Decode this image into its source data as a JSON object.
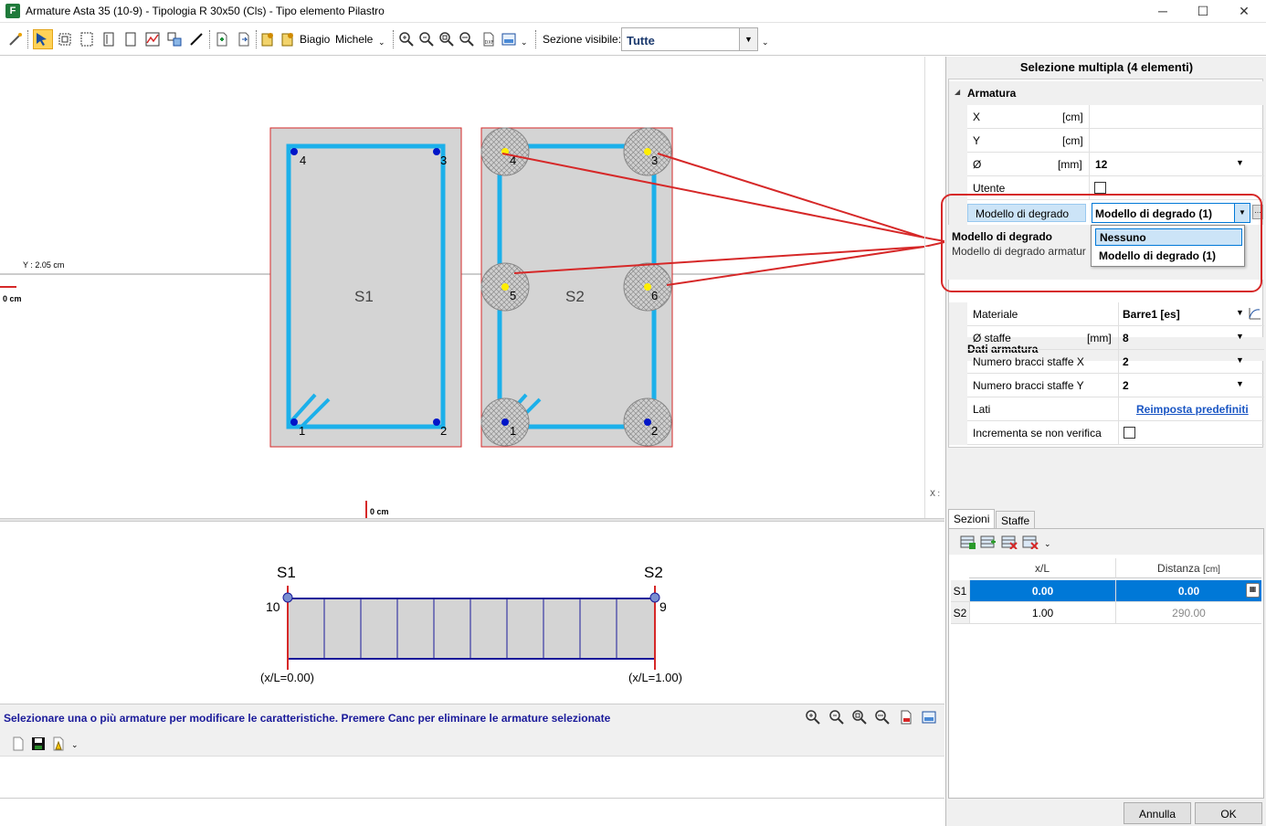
{
  "window": {
    "title": "Armature Asta 35 (10-9) - Tipologia R 30x50 (Cls) - Tipo elemento Pilastro",
    "minimize": "─",
    "maximize": "☐",
    "close": "✕"
  },
  "toolbar": {
    "user1": "Biagio",
    "user2": "Michele",
    "section_label": "Sezione visibile:",
    "section_value": "Tutte"
  },
  "drawing": {
    "y_label": "Y : 2.05 cm",
    "x_zero": "0 cm",
    "y_zero": "0 cm",
    "x_cursor": "X :",
    "section1": {
      "label": "S1",
      "nodes": [
        "4",
        "3",
        "1",
        "2"
      ]
    },
    "section2": {
      "label": "S2",
      "nodes": [
        "4",
        "3",
        "5",
        "6",
        "1",
        "2"
      ]
    },
    "elevation": {
      "left_label": "S1",
      "right_label": "S2",
      "left_node": "10",
      "right_node": "9",
      "left_pos": "(x/L=0.00)",
      "right_pos": "(x/L=1.00)"
    }
  },
  "status": {
    "message": "Selezionare una o più armature per modificare le caratteristiche. Premere Canc per eliminare le armature selezionate"
  },
  "panel": {
    "title": "Selezione multipla (4 elementi)",
    "armatura_header": "Armatura",
    "rows": {
      "x": {
        "name": "X",
        "unit": "[cm]",
        "value": ""
      },
      "y": {
        "name": "Y",
        "unit": "[cm]",
        "value": ""
      },
      "diam": {
        "name": "Ø",
        "unit": "[mm]",
        "value": "12"
      },
      "utente": {
        "name": "Utente"
      }
    },
    "degrado": {
      "name": "Modello di degrado",
      "value": "Modello di degrado (1)",
      "desc_title": "Modello di degrado",
      "desc_text": "Modello di degrado armatur",
      "options": [
        "Nessuno",
        "Modello di degrado (1)"
      ]
    },
    "dati_header": "Dati armatura",
    "dati_rows": {
      "materiale": {
        "name": "Materiale",
        "value": "Barre1 [es]"
      },
      "staffe": {
        "name": "Ø staffe",
        "unit": "[mm]",
        "value": "8"
      },
      "bracci_x": {
        "name": "Numero bracci staffe X",
        "value": "2"
      },
      "bracci_y": {
        "name": "Numero bracci staffe Y",
        "value": "2"
      },
      "lati": {
        "name": "Lati",
        "value": "Reimposta predefiniti"
      },
      "incrementa": {
        "name": "Incrementa se non verifica"
      }
    }
  },
  "tabs": {
    "sezioni": "Sezioni",
    "staffe": "Staffe"
  },
  "table": {
    "col_xl": "x/L",
    "col_dist": "Distanza",
    "col_dist_unit": "[cm]",
    "rows": [
      {
        "id": "S1",
        "xl": "0.00",
        "dist": "0.00"
      },
      {
        "id": "S2",
        "xl": "1.00",
        "dist": "290.00"
      }
    ]
  },
  "buttons": {
    "cancel": "Annulla",
    "ok": "OK"
  },
  "colors": {
    "rebar": "#1cb0ea",
    "section_fill": "#d4d4d4",
    "section_border": "#d62828",
    "callout": "#d62828",
    "node": "#0015c8",
    "selected_node": "#ffee00",
    "status_text": "#1a1a9a",
    "selection": "#0078d7"
  }
}
